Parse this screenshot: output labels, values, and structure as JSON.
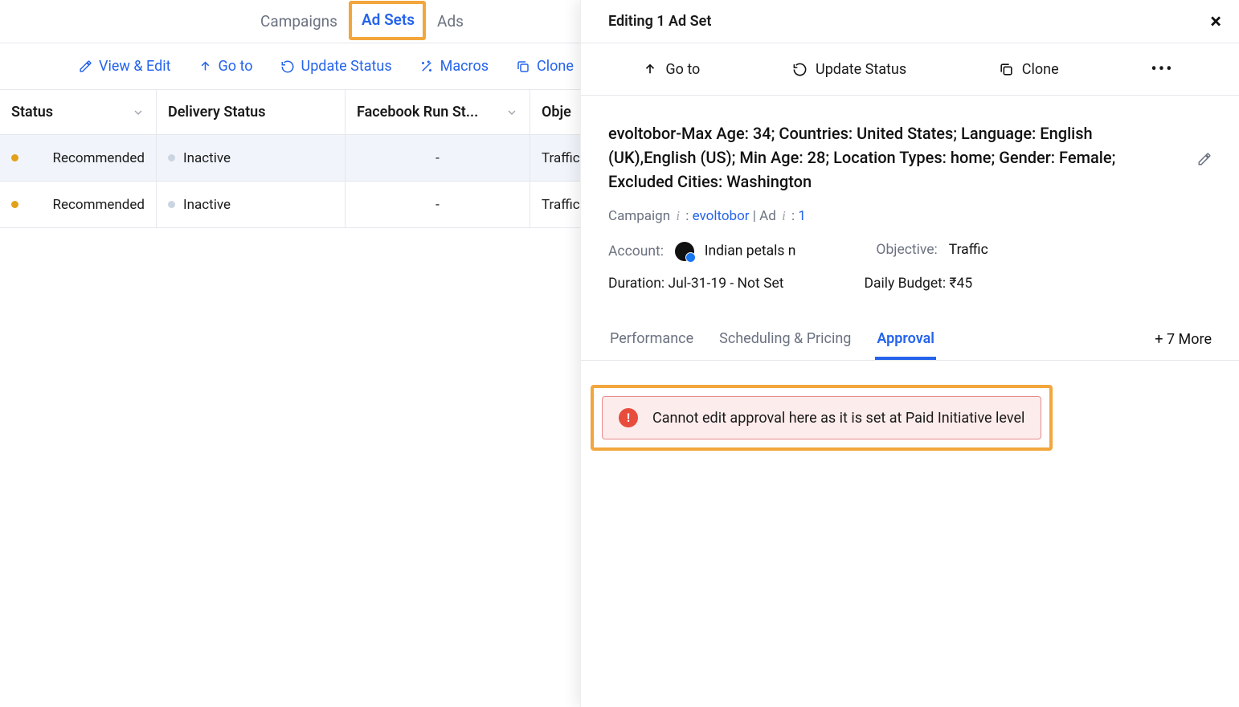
{
  "top_tabs": {
    "campaigns": "Campaigns",
    "ad_sets": "Ad Sets",
    "ads": "Ads"
  },
  "actions": {
    "view_edit": "View & Edit",
    "goto": "Go to",
    "update_status": "Update Status",
    "macros": "Macros",
    "clone": "Clone"
  },
  "table": {
    "headers": {
      "status": "Status",
      "delivery": "Delivery Status",
      "fbrun": "Facebook Run St...",
      "objective": "Obje"
    },
    "rows": [
      {
        "status": "Recommended",
        "delivery": "Inactive",
        "fbrun": "-",
        "objective": "Traffic"
      },
      {
        "status": "Recommended",
        "delivery": "Inactive",
        "fbrun": "-",
        "objective": "Traffic"
      }
    ]
  },
  "panel": {
    "title": "Editing 1 Ad Set",
    "actions": {
      "goto": "Go to",
      "update_status": "Update Status",
      "clone": "Clone"
    },
    "long_title": "evoltobor-Max Age: 34; Countries: United States; Language: English (UK),English (US); Min Age: 28; Location Types: home; Gender: Female; Excluded Cities: Washington",
    "meta": {
      "campaign_label": "Campaign",
      "campaign_link": "evoltobor",
      "ad_label": "Ad",
      "ad_link": "1"
    },
    "info": {
      "account_label": "Account:",
      "account_value": "Indian petals n",
      "objective_label": "Objective:",
      "objective_value": "Traffic",
      "duration_label": "Duration:",
      "duration_value": "Jul-31-19 - Not Set",
      "budget_label": "Daily Budget:",
      "budget_value": "₹45"
    },
    "sub_tabs": {
      "performance": "Performance",
      "scheduling": "Scheduling & Pricing",
      "approval": "Approval",
      "more": "+ 7 More"
    },
    "alert": "Cannot edit approval here as it is set at Paid Initiative level"
  }
}
